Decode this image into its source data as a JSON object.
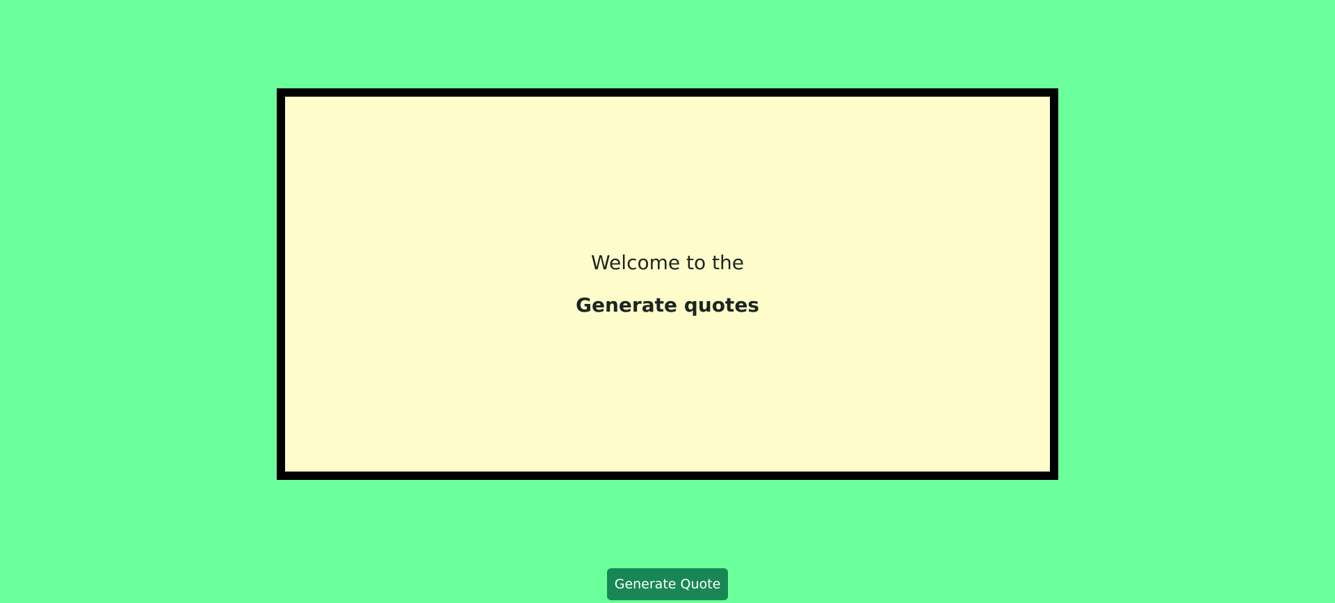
{
  "card": {
    "welcome": "Welcome to the",
    "headline": "Generate quotes"
  },
  "actions": {
    "generate_label": "Generate Quote"
  },
  "colors": {
    "page_background": "#6bff9b",
    "card_background": "#fffccb",
    "card_border": "#000000",
    "button_background": "#198754",
    "button_text": "#ffffff"
  }
}
